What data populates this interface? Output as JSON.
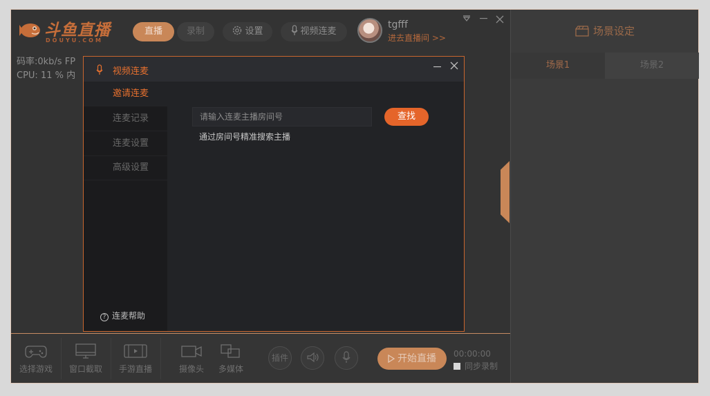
{
  "header": {
    "brand": "斗鱼直播",
    "brand_sub": "DOUYU.COM",
    "live_label": "直播",
    "record_label": "录制",
    "settings_label": "设置",
    "vlink_label": "视频连麦",
    "username": "tgfff",
    "enter_room": "进去直播间 >>"
  },
  "stats": {
    "line1": "码率:0kb/s   FP",
    "line2": "CPU: 11 %    内"
  },
  "right_panel": {
    "title": "场景设定",
    "tabs": [
      "场景1",
      "场景2"
    ]
  },
  "toolbar": {
    "tools": [
      "选择游戏",
      "窗口截取",
      "手游直播",
      "摄像头",
      "多媒体"
    ],
    "plugin_label": "插件",
    "start_label": "开始直播",
    "timer": "00:00:00",
    "sync_label": "同步录制"
  },
  "modal": {
    "title": "视频连麦",
    "nav": [
      "邀请连麦",
      "连麦记录",
      "连麦设置",
      "高级设置"
    ],
    "input_placeholder": "请输入连麦主播房间号",
    "search_label": "查找",
    "hint": "通过房间号精准搜索主播",
    "help_label": "连麦帮助"
  },
  "colors": {
    "accent": "#e5702f",
    "accent_dim": "#c98758",
    "panel": "#333333",
    "modal_bg": "#222326"
  },
  "icons": [
    "douyu-fish-logo-icon",
    "gear-icon",
    "microphone-icon",
    "dropdown-triangle-icon",
    "minimize-icon",
    "close-icon",
    "clapperboard-icon",
    "gamepad-icon",
    "monitor-icon",
    "phone-screen-icon",
    "camera-icon",
    "media-icon",
    "speaker-icon",
    "play-icon",
    "help-circle-icon"
  ]
}
